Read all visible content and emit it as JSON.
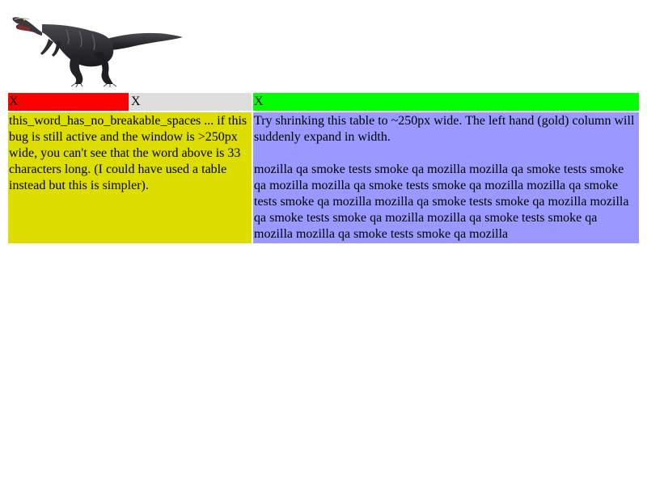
{
  "image": {
    "alt": "dinosaur-image"
  },
  "table": {
    "header_row": {
      "red_cell": "X",
      "gray_cell": "X",
      "green_cell": "X"
    },
    "body_row": {
      "gold_cell_text": "this_word_has_no_breakable_spaces ... if this bug is still active and the window is >250px wide, you can't see that the word above is 33 characters long. (I could have used a table instead but this is simpler).",
      "blue_cell_intro": "Try shrinking this table to ~250px wide. The left hand (gold) column will suddenly expand in width.",
      "blue_cell_filler": "mozilla qa smoke tests smoke qa mozilla mozilla qa smoke tests smoke qa mozilla mozilla qa smoke tests smoke qa mozilla mozilla qa smoke tests smoke qa mozilla mozilla qa smoke tests smoke qa mozilla mozilla qa smoke tests smoke qa mozilla mozilla qa smoke tests smoke qa mozilla mozilla qa smoke tests smoke qa mozilla"
    }
  },
  "colors": {
    "red": "#ff0000",
    "gray": "#dddddd",
    "green": "#00ff00",
    "gold": "#dddd00",
    "blue": "#9999ff"
  }
}
